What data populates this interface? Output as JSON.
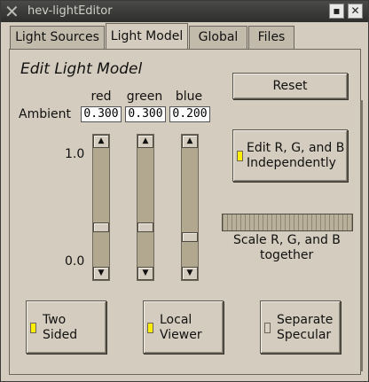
{
  "window": {
    "title": "hev-lightEditor",
    "minimize_glyph": "▪",
    "close_glyph": "✕",
    "logo_glyph": "✕"
  },
  "tabs": [
    {
      "label": "Light Sources",
      "active": false
    },
    {
      "label": "Light Model",
      "active": true
    },
    {
      "label": "Global",
      "active": false
    },
    {
      "label": "Files",
      "active": false
    }
  ],
  "panel": {
    "heading": "Edit Light Model",
    "reset_label": "Reset",
    "ambient_label": "Ambient",
    "columns": [
      {
        "label": "red",
        "value": "0.300",
        "level": 0.3
      },
      {
        "label": "green",
        "value": "0.300",
        "level": 0.3
      },
      {
        "label": "blue",
        "value": "0.200",
        "level": 0.2
      }
    ],
    "scale_max": "1.0",
    "scale_min": "0.0",
    "edit_independent": {
      "line1": "Edit R, G, and B",
      "line2": "Independently",
      "on": true
    },
    "scale_together": {
      "line1": "Scale R, G, and B",
      "line2": "together"
    },
    "two_sided": {
      "line1": "Two",
      "line2": "Sided",
      "on": true
    },
    "local_viewer": {
      "line1": "Local",
      "line2": "Viewer",
      "on": true
    },
    "separate_specular": {
      "line1": "Separate",
      "line2": "Specular",
      "on": false
    }
  },
  "colors": {
    "indicator_on": "#ffee00",
    "indicator_off": "#d8d0c2",
    "background": "#d4ccbe"
  },
  "icons": {
    "arrow_up": "▲",
    "arrow_down": "▼"
  }
}
